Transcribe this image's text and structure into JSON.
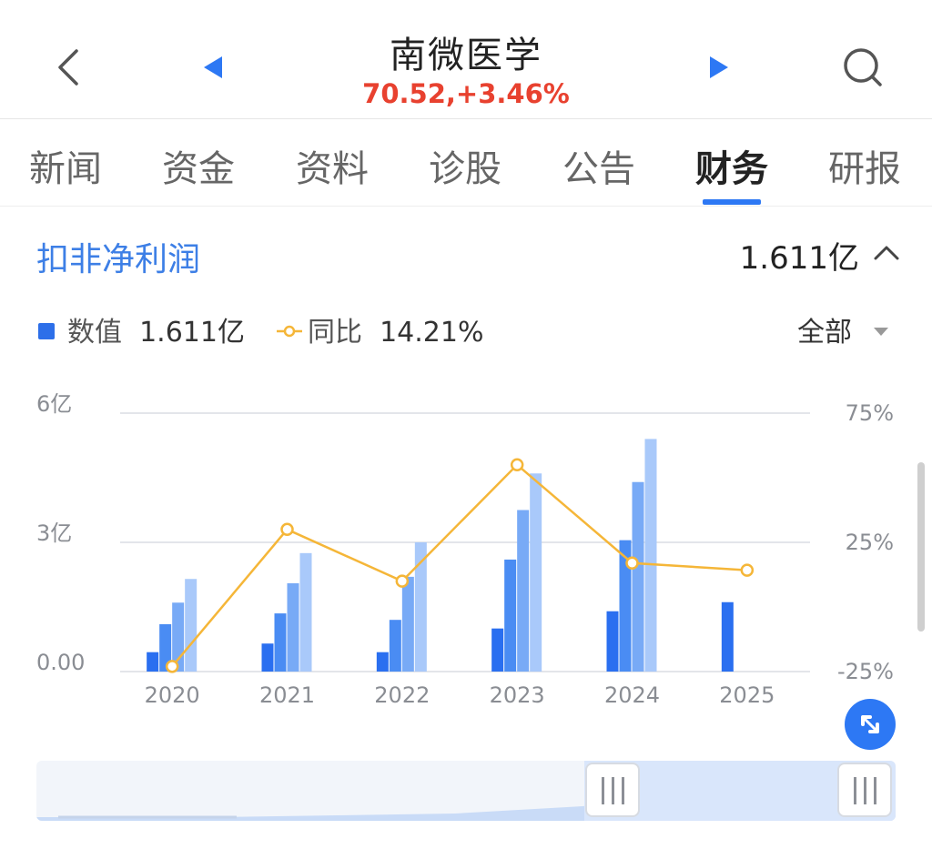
{
  "header": {
    "title": "南微医学",
    "price": "70.52,+3.46%",
    "price_color": "#e8412f"
  },
  "icons": {
    "back": "chevron-left-icon",
    "prev": "triangle-left-icon",
    "next": "triangle-right-icon",
    "search": "search-icon",
    "collapse": "chevron-up-icon",
    "dropdown": "triangle-down-icon",
    "fullscreen": "expand-icon"
  },
  "tabs": [
    {
      "label": "新闻"
    },
    {
      "label": "资金"
    },
    {
      "label": "资料"
    },
    {
      "label": "诊股"
    },
    {
      "label": "公告"
    },
    {
      "label": "财务",
      "active": true
    },
    {
      "label": "研报"
    }
  ],
  "section": {
    "title": "扣非净利润",
    "value": "1.611亿"
  },
  "legend": {
    "value_label": "数值",
    "value": "1.611亿",
    "yoy_label": "同比",
    "yoy": "14.21%",
    "range": "全部"
  },
  "colors": {
    "accent": "#2d78f4",
    "bar_shades": [
      "#2a6ff0",
      "#4a8cf3",
      "#78aaf6",
      "#a9c9fa"
    ],
    "line": "#f5b638"
  },
  "chart_data": {
    "type": "bar",
    "categories": [
      "2020",
      "2021",
      "2022",
      "2023",
      "2024",
      "2025"
    ],
    "series": [
      {
        "values": [
          0.45,
          0.65,
          0.45,
          1.0,
          1.4,
          1.611
        ]
      },
      {
        "values": [
          1.1,
          1.35,
          1.2,
          2.6,
          3.05,
          null
        ]
      },
      {
        "values": [
          1.6,
          2.05,
          2.2,
          3.75,
          4.4,
          null
        ]
      },
      {
        "values": [
          2.15,
          2.75,
          3.0,
          4.6,
          5.4,
          null
        ]
      }
    ],
    "line_series": {
      "values": [
        -23,
        30,
        10,
        55,
        17,
        14.21
      ]
    },
    "y_left": {
      "ticks": [
        "0.00",
        "3亿",
        "6亿"
      ],
      "range": [
        0,
        6
      ]
    },
    "y_right": {
      "ticks": [
        "-25%",
        "25%",
        "75%"
      ],
      "range": [
        -25,
        75
      ]
    },
    "grid": true
  }
}
